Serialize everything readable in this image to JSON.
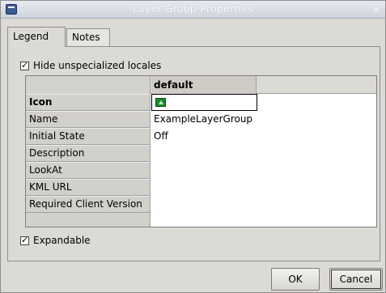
{
  "window": {
    "title": "Layer Group Properties",
    "close_glyph": "×"
  },
  "tabs": [
    {
      "label": "Legend",
      "active": true
    },
    {
      "label": "Notes",
      "active": false
    }
  ],
  "options": {
    "hide_unspecialized": {
      "label": "Hide unspecialized locales",
      "checked": true
    },
    "expandable": {
      "label": "Expandable",
      "checked": true
    }
  },
  "grid": {
    "column_header": "default",
    "rows": [
      {
        "label": "Icon",
        "value": "",
        "icon": "layer-group-icon"
      },
      {
        "label": "Name",
        "value": "ExampleLayerGroup"
      },
      {
        "label": "Initial State",
        "value": "Off"
      },
      {
        "label": "Description",
        "value": ""
      },
      {
        "label": "LookAt",
        "value": ""
      },
      {
        "label": "KML URL",
        "value": ""
      },
      {
        "label": "Required Client Version",
        "value": ""
      }
    ]
  },
  "buttons": {
    "ok": "OK",
    "cancel": "Cancel"
  },
  "colors": {
    "dialog_bg": "#dcdad5",
    "icon_green": "#1f8a2f"
  }
}
